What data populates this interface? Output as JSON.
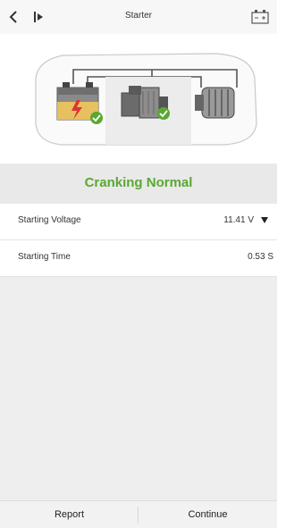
{
  "header": {
    "title": "Starter",
    "back_icon": "chevron-left-icon",
    "exit_icon": "exit-icon",
    "battery_icon": "battery-icon"
  },
  "illustration": {
    "components": [
      "battery",
      "starter-motor",
      "alternator"
    ],
    "check_color": "#5aa831"
  },
  "status": {
    "text": "Cranking Normal",
    "color": "#5aa831"
  },
  "results": [
    {
      "label": "Starting Voltage",
      "value": "11.41 V",
      "has_dropdown": true
    },
    {
      "label": "Starting Time",
      "value": "0.53 S",
      "has_dropdown": false
    }
  ],
  "footer": {
    "report_label": "Report",
    "continue_label": "Continue"
  }
}
